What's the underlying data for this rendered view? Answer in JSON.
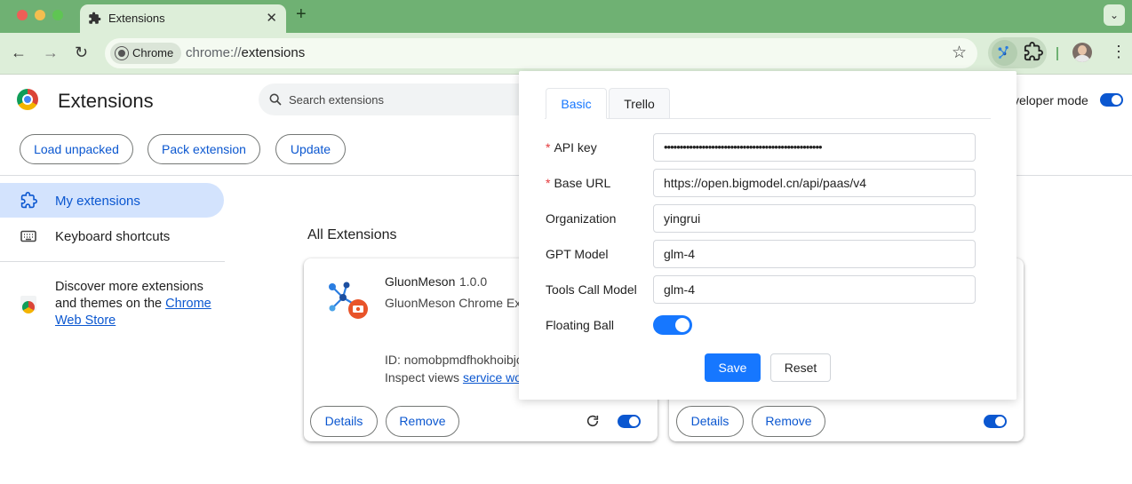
{
  "window": {
    "tab_title": "Extensions",
    "tab_close": "✕",
    "new_tab": "+",
    "tab_menu": "⌄"
  },
  "toolbar": {
    "back": "←",
    "forward": "→",
    "reload": "↻",
    "site_chip": "Chrome",
    "url_scheme": "chrome://",
    "url_path": "extensions",
    "bookmark": "☆",
    "menu": "⋮"
  },
  "page": {
    "title": "Extensions",
    "search_placeholder": "Search extensions",
    "developer_mode_label": "veloper mode",
    "developer_mode_on": true,
    "buttons": {
      "load_unpacked": "Load unpacked",
      "pack_extension": "Pack extension",
      "update": "Update"
    }
  },
  "sidebar": {
    "my_extensions": "My extensions",
    "keyboard_shortcuts": "Keyboard shortcuts",
    "discover_prefix": "Discover more extensions and themes on the ",
    "discover_link": "Chrome Web Store"
  },
  "main": {
    "section_title": "All Extensions",
    "cards": [
      {
        "name": "GluonMeson",
        "version": "1.0.0",
        "description": "GluonMeson Chrome Ext",
        "id_line": "ID: nomobpmdfhokhoibjc",
        "inspect_prefix": "Inspect views ",
        "inspect_link": "service wo",
        "details": "Details",
        "remove": "Remove",
        "enabled": true
      },
      {
        "details": "Details",
        "remove": "Remove",
        "enabled": true
      }
    ]
  },
  "popup": {
    "tabs": [
      {
        "label": "Basic",
        "active": true
      },
      {
        "label": "Trello",
        "active": false
      }
    ],
    "fields": [
      {
        "label": "API key",
        "required": true,
        "value": "••••••••••••••••••••••••••••••••••••••••••••••••••"
      },
      {
        "label": "Base URL",
        "required": true,
        "value": "https://open.bigmodel.cn/api/paas/v4"
      },
      {
        "label": "Organization",
        "required": false,
        "value": "yingrui"
      },
      {
        "label": "GPT Model",
        "required": false,
        "value": "glm-4"
      },
      {
        "label": "Tools Call Model",
        "required": false,
        "value": "glm-4"
      }
    ],
    "required_mark": "*",
    "floating_ball_label": "Floating Ball",
    "floating_ball_on": true,
    "save": "Save",
    "reset": "Reset"
  },
  "colors": {
    "accent": "#0b57d0",
    "popup_primary": "#1677ff",
    "frame": "#6fb173",
    "toolbar": "#ddeed9"
  }
}
